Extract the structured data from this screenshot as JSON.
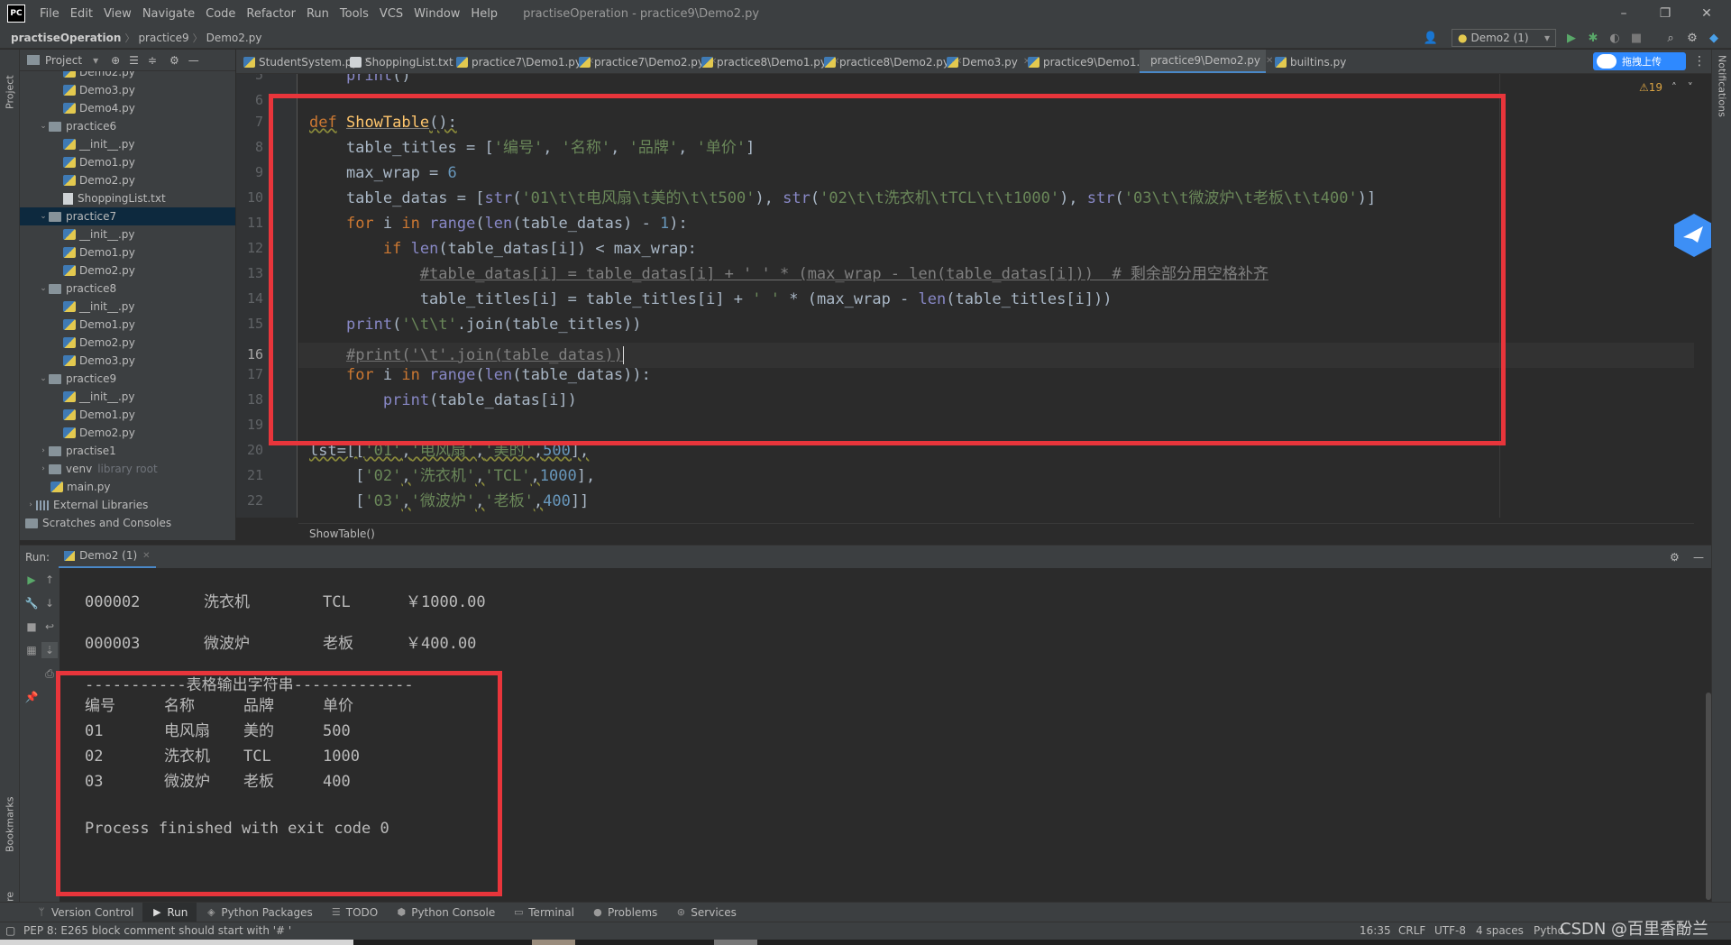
{
  "window": {
    "logo": "PC",
    "title": "practiseOperation - practice9\\Demo2.py",
    "menu": [
      "File",
      "Edit",
      "View",
      "Navigate",
      "Code",
      "Refactor",
      "Run",
      "Tools",
      "VCS",
      "Window",
      "Help"
    ],
    "controls": {
      "minimize": "–",
      "restore": "❐",
      "close": "✕"
    }
  },
  "navbar": {
    "project": "practiseOperation",
    "folder": "practice9",
    "file": "Demo2.py",
    "run_config": "Demo2 (1)"
  },
  "project_panel": {
    "title": "Project",
    "tree": [
      {
        "label": "Demo2.py",
        "type": "py",
        "indent": 3
      },
      {
        "label": "Demo3.py",
        "type": "py",
        "indent": 3
      },
      {
        "label": "Demo4.py",
        "type": "py",
        "indent": 3
      },
      {
        "label": "practice6",
        "type": "folder",
        "indent": 1,
        "expanded": true
      },
      {
        "label": "__init__.py",
        "type": "py",
        "indent": 3
      },
      {
        "label": "Demo1.py",
        "type": "py",
        "indent": 3
      },
      {
        "label": "Demo2.py",
        "type": "py",
        "indent": 3
      },
      {
        "label": "ShoppingList.txt",
        "type": "txt",
        "indent": 3
      },
      {
        "label": "practice7",
        "type": "folder",
        "indent": 1,
        "expanded": true,
        "selected": true
      },
      {
        "label": "__init__.py",
        "type": "py",
        "indent": 3
      },
      {
        "label": "Demo1.py",
        "type": "py",
        "indent": 3
      },
      {
        "label": "Demo2.py",
        "type": "py",
        "indent": 3
      },
      {
        "label": "practice8",
        "type": "folder",
        "indent": 1,
        "expanded": true
      },
      {
        "label": "__init__.py",
        "type": "py",
        "indent": 3
      },
      {
        "label": "Demo1.py",
        "type": "py",
        "indent": 3
      },
      {
        "label": "Demo2.py",
        "type": "py",
        "indent": 3
      },
      {
        "label": "Demo3.py",
        "type": "py",
        "indent": 3
      },
      {
        "label": "practice9",
        "type": "folder",
        "indent": 1,
        "expanded": true
      },
      {
        "label": "__init__.py",
        "type": "py",
        "indent": 3
      },
      {
        "label": "Demo1.py",
        "type": "py",
        "indent": 3
      },
      {
        "label": "Demo2.py",
        "type": "py",
        "indent": 3
      },
      {
        "label": "practise1",
        "type": "folder",
        "indent": 1,
        "expanded": false
      },
      {
        "label": "venv",
        "type": "folder",
        "indent": 1,
        "expanded": false,
        "note": "library root"
      },
      {
        "label": "main.py",
        "type": "py",
        "indent": 2
      },
      {
        "label": "External Libraries",
        "type": "lib",
        "indent": 0,
        "expanded": false
      },
      {
        "label": "Scratches and Consoles",
        "type": "scratch",
        "indent": 0
      }
    ]
  },
  "tabs": [
    {
      "label": "StudentSystem.py"
    },
    {
      "label": "ShoppingList.txt"
    },
    {
      "label": "practice7\\Demo1.py"
    },
    {
      "label": "practice7\\Demo2.py"
    },
    {
      "label": "practice8\\Demo1.py"
    },
    {
      "label": "practice8\\Demo2.py"
    },
    {
      "label": "Demo3.py"
    },
    {
      "label": "practice9\\Demo1.py"
    },
    {
      "label": "practice9\\Demo2.py",
      "active": true
    },
    {
      "label": "builtins.py"
    }
  ],
  "upload_button": "拖拽上传",
  "inspection": "⚠19",
  "editor": {
    "line_numbers": [
      "5",
      "6",
      "7",
      "8",
      "9",
      "10",
      "11",
      "12",
      "13",
      "14",
      "15",
      "16",
      "17",
      "18",
      "19",
      "20",
      "21",
      "22"
    ],
    "current_line": "16",
    "breadcrumb": "ShowTable()"
  },
  "run_panel": {
    "label": "Run:",
    "tab": "Demo2 (1)",
    "console_rows": [
      [
        "000002",
        "洗衣机",
        "TCL",
        "￥1000.00"
      ],
      [
        "000003",
        "微波炉",
        "老板",
        "￥400.00"
      ]
    ],
    "table_header_line": "-----------表格输出字符串-------------",
    "table_titles": [
      "编号",
      "名称",
      "品牌",
      "单价"
    ],
    "table_rows": [
      [
        "01",
        "电风扇",
        "美的",
        "500"
      ],
      [
        "02",
        "洗衣机",
        "TCL",
        "1000"
      ],
      [
        "03",
        "微波炉",
        "老板",
        "400"
      ]
    ],
    "exit_message": "Process finished with exit code 0"
  },
  "bottom_tools": [
    {
      "label": "Version Control",
      "icon": "branch-icon"
    },
    {
      "label": "Run",
      "icon": "play-icon",
      "active": true
    },
    {
      "label": "Python Packages",
      "icon": "packages-icon"
    },
    {
      "label": "TODO",
      "icon": "list-icon"
    },
    {
      "label": "Python Console",
      "icon": "python-icon"
    },
    {
      "label": "Terminal",
      "icon": "terminal-icon"
    },
    {
      "label": "Problems",
      "icon": "problems-icon"
    },
    {
      "label": "Services",
      "icon": "services-icon"
    }
  ],
  "status": {
    "message": "PEP 8: E265 block comment should start with '# '",
    "position": "16:35",
    "line_sep": "CRLF",
    "encoding": "UTF-8",
    "indent": "4 spaces",
    "interpreter": "Pytho"
  },
  "side_tabs": {
    "project": "Project",
    "bookmarks": "Bookmarks",
    "structure": "Structure",
    "notifications": "Notifications"
  },
  "watermark": "CSDN @百里香酚兰",
  "colors": {
    "accent": "#4a88c7",
    "highlight_box": "#e8353b",
    "keyword": "#cc7832",
    "string": "#6a8759",
    "number": "#6897bb"
  }
}
